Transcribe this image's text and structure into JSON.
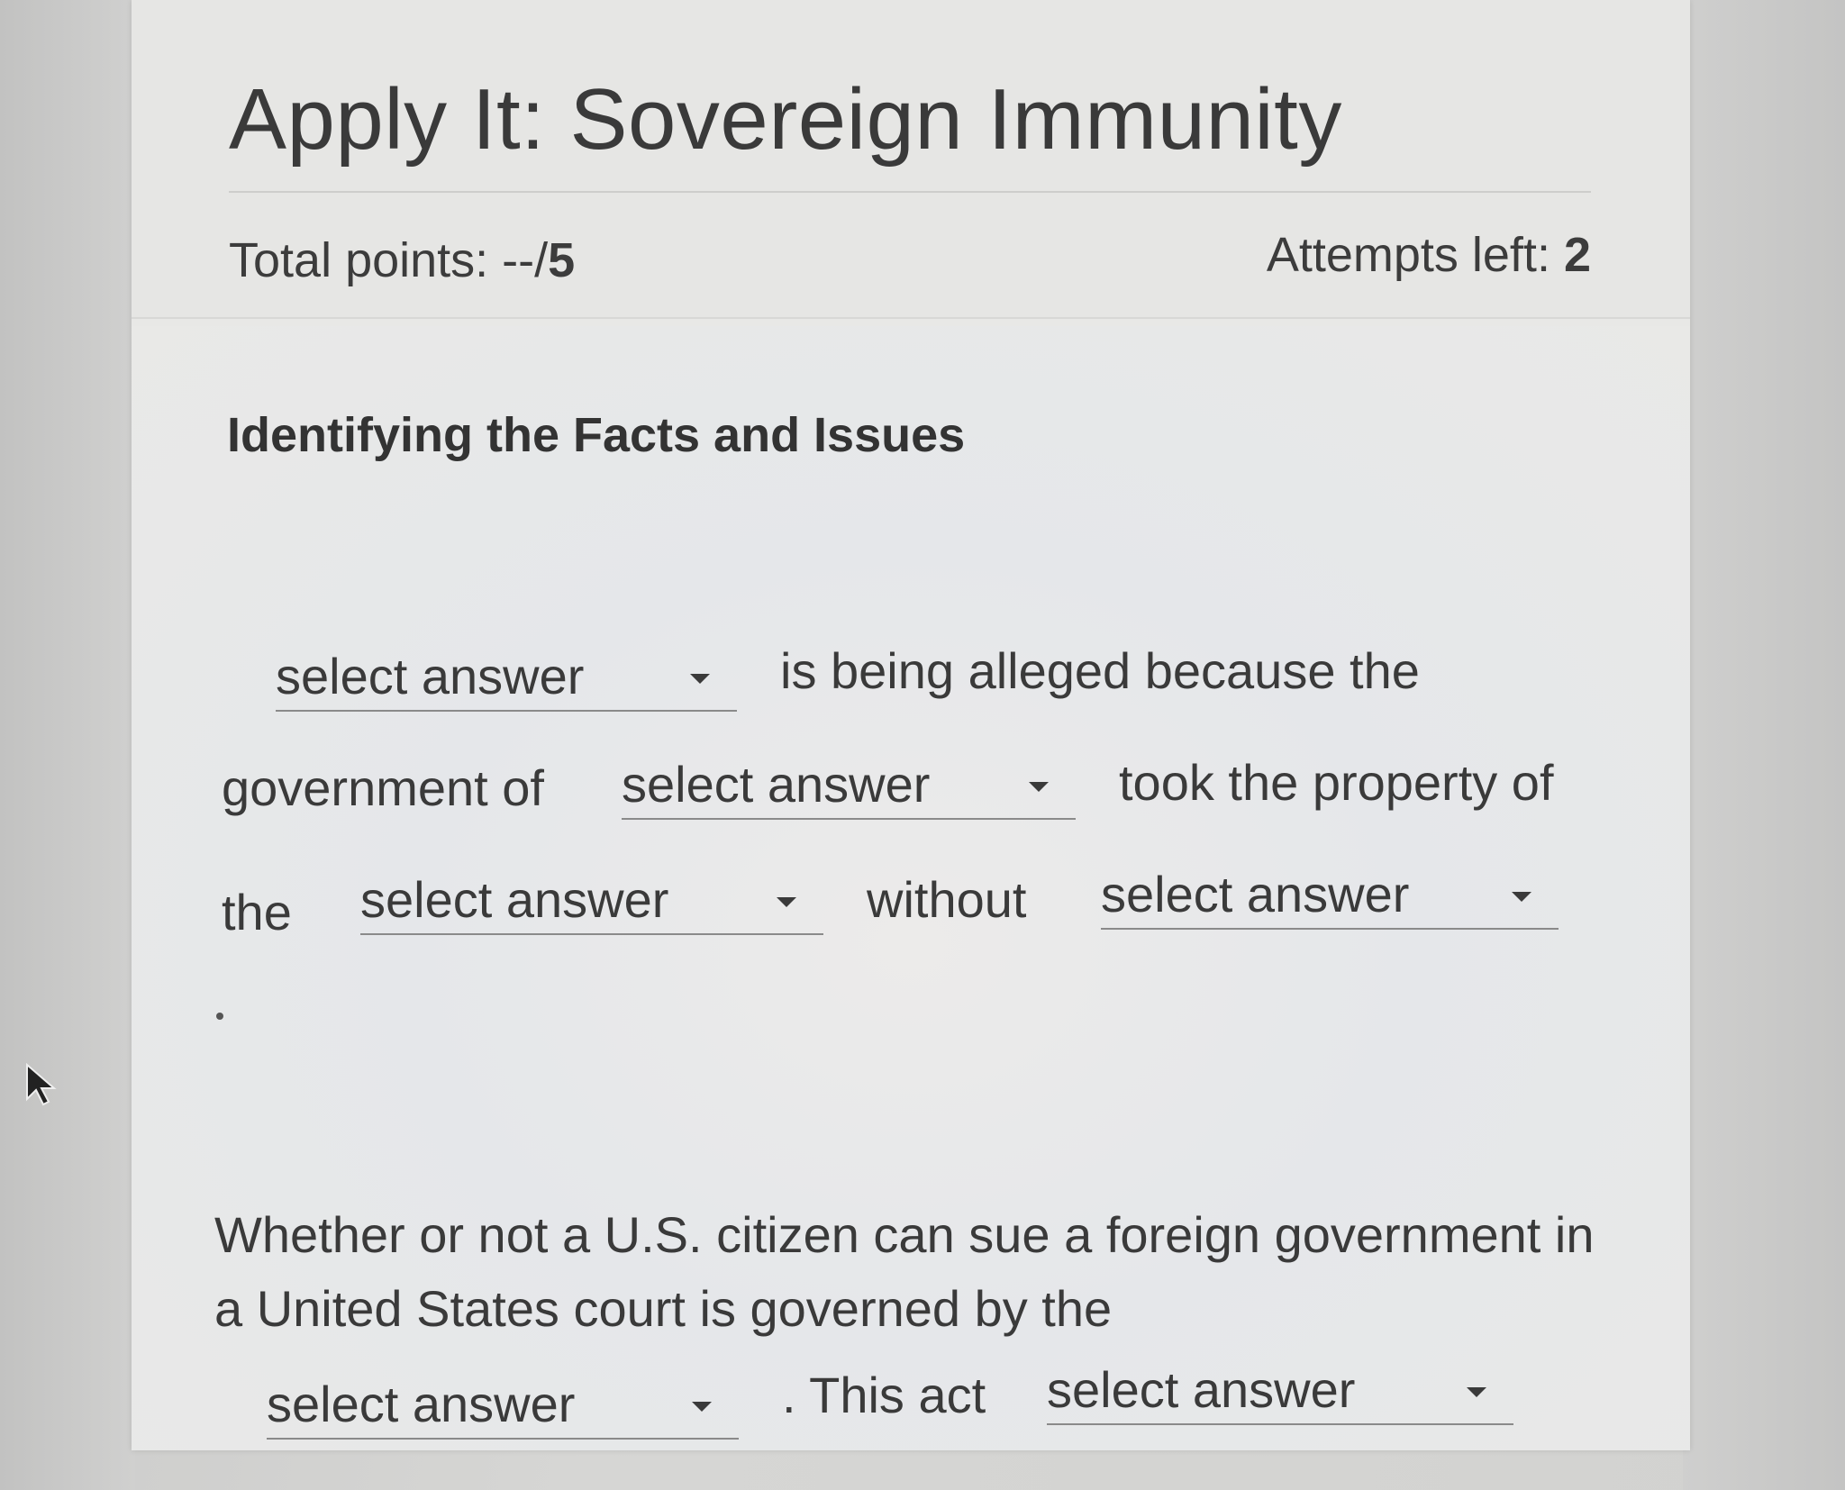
{
  "header": {
    "title": "Apply It: Sovereign Immunity",
    "points_label": "Total points: --/",
    "points_value": "5",
    "attempts_label": "Attempts left: ",
    "attempts_value": "2"
  },
  "section": {
    "heading": "Identifying the Facts and Issues"
  },
  "question1": {
    "select1": "select answer",
    "text1": "is being alleged because the",
    "text2": "government of",
    "select2": "select answer",
    "text3": "took the property of",
    "text4": "the",
    "select3": "select answer",
    "text5": "without",
    "select4": "select answer",
    "period": "."
  },
  "question2": {
    "line1": "Whether or not a U.S. citizen can sue a foreign government in",
    "line2": "a United States court is governed by the",
    "select1": "select answer",
    "text1": ". This act",
    "select2": "select answer"
  },
  "icons": {
    "dropdown": "caret-down-icon",
    "cursor": "mouse-pointer-icon"
  }
}
